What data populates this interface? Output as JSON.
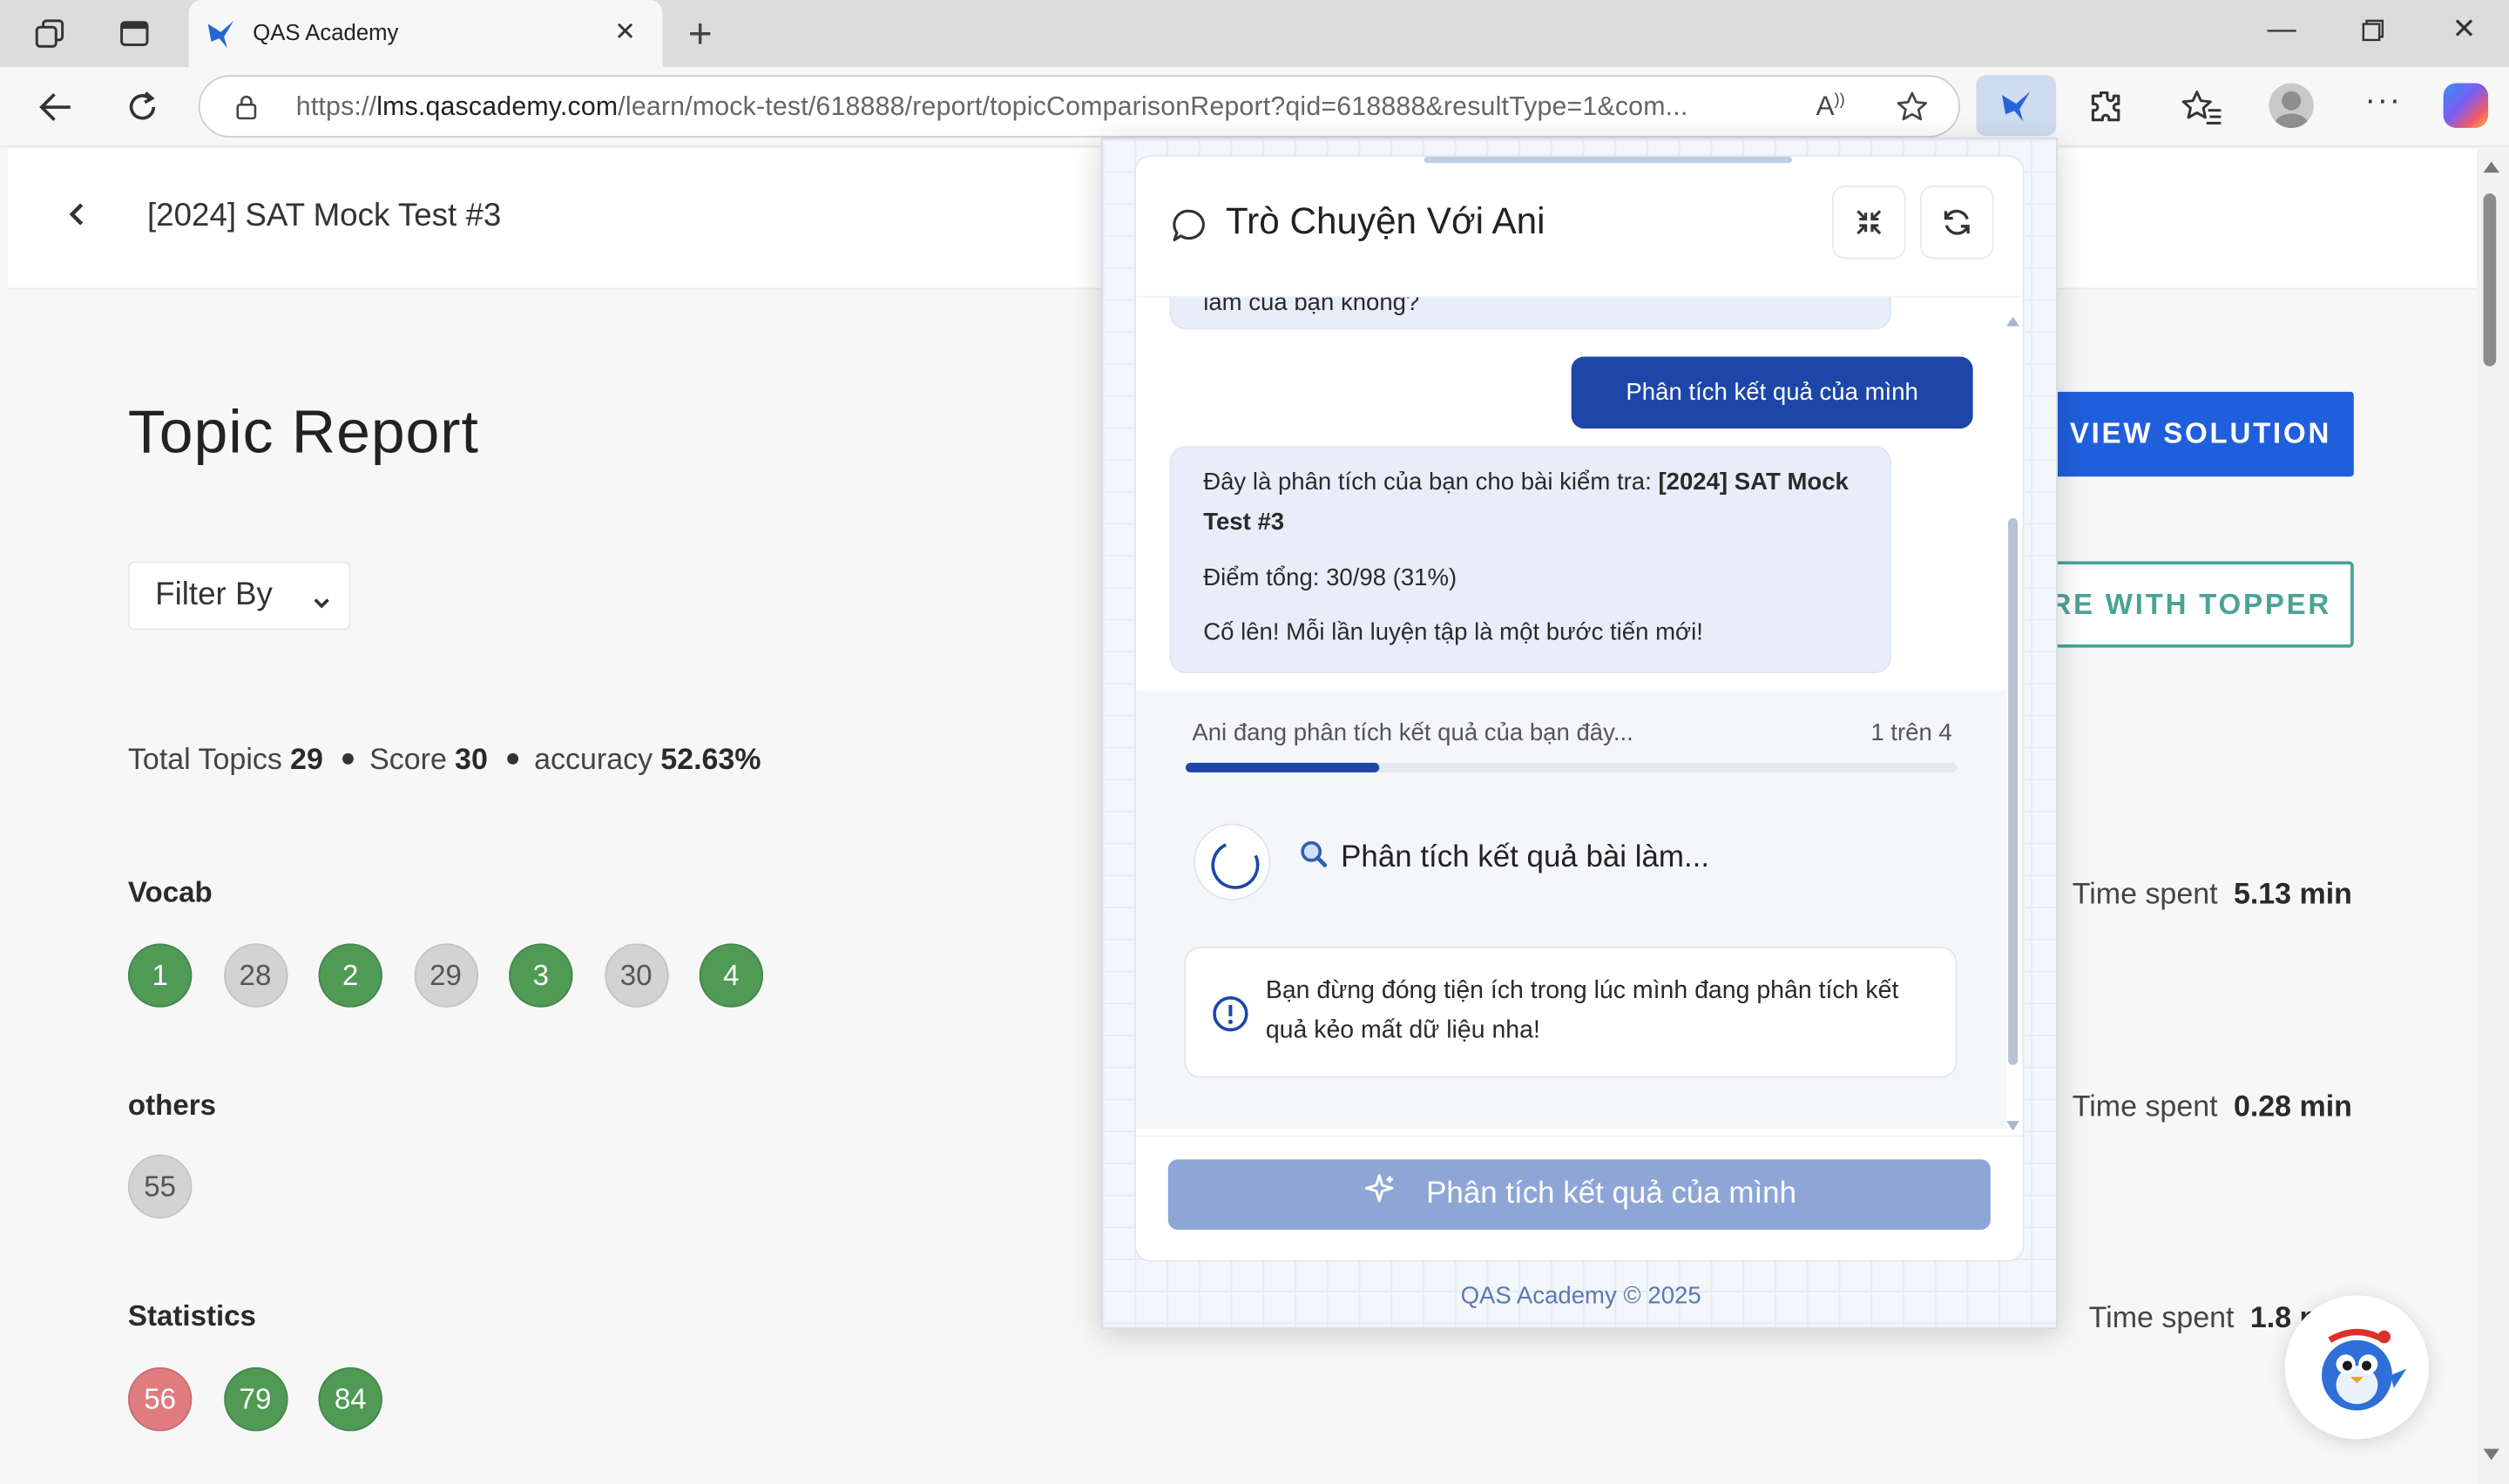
{
  "browser": {
    "tab_title": "QAS Academy",
    "url_prefix": "https://",
    "url_host": "lms.qascademy.com",
    "url_path": "/learn/mock-test/618888/report/topicComparisonReport?qid=618888&resultType=1&com..."
  },
  "page": {
    "title": "[2024] SAT Mock Test #3",
    "heading": "Topic Report",
    "filter_label": "Filter By",
    "stats": {
      "total_topics_label": "Total Topics",
      "total_topics_value": "29",
      "score_label": "Score",
      "score_value": "30",
      "accuracy_label": "accuracy",
      "accuracy_value": "52.63%"
    },
    "sections": [
      {
        "name": "Vocab",
        "items": [
          "1",
          "28",
          "2",
          "29",
          "3",
          "30",
          "4"
        ],
        "status": [
          "correct",
          "unanswered",
          "correct",
          "unanswered",
          "correct",
          "unanswered",
          "correct"
        ],
        "time_label": "Time spent",
        "time_value": "5.13 min"
      },
      {
        "name": "others",
        "items": [
          "55"
        ],
        "status": [
          "unanswered"
        ],
        "time_label": "Time spent",
        "time_value": "0.28 min"
      },
      {
        "name": "Statistics",
        "items": [
          "56",
          "79",
          "84"
        ],
        "status": [
          "incorrect",
          "correct",
          "correct"
        ],
        "time_label": "Time spent",
        "time_value": "1.8 min"
      }
    ],
    "view_solution_label": "VIEW SOLUTION",
    "compare_label": "RE WITH TOPPER"
  },
  "chat": {
    "title": "Trò Chuyện Với Ani",
    "partial_message": "làm của bạn không?",
    "user_message": "Phân tích kết quả của mình",
    "bot_message": {
      "intro": "Đây là phân tích của bạn cho bài kiểm tra:",
      "test_name": "[2024] SAT Mock Test #3",
      "score_line": "Điểm tổng: 30/98 (31%)",
      "encouragement": "Cố lên! Mỗi lần luyện tập là một bước tiến mới!"
    },
    "progress_label": "Ani đang phân tích kết quả của bạn đây...",
    "progress_count": "1 trên 4",
    "progress_fraction": 0.25,
    "step_text": "Phân tích kết quả bài làm...",
    "warning": "Bạn đừng đóng tiện ích trong lúc mình đang phân tích kết quả kẻo mất dữ liệu nha!",
    "analyze_button": "Phân tích kết quả của mình",
    "copyright": "QAS Academy © 2025"
  },
  "colors": {
    "correct": "#4f9a55",
    "unanswered": "#d3d3d3",
    "incorrect": "#e07c80",
    "primary": "#1f5fdc",
    "chat_primary": "#1d46a8",
    "topper": "#4aa394"
  },
  "icons": [
    "workspaces-icon",
    "tab-actions-icon",
    "qas-favicon",
    "close-icon",
    "plus-icon",
    "minimize-icon",
    "restore-icon",
    "window-close-icon",
    "back-arrow-icon",
    "refresh-icon",
    "lock-icon",
    "read-aloud-icon",
    "star-icon",
    "extension-icon",
    "favorites-icon",
    "profile-icon",
    "more-icon",
    "copilot-icon",
    "chevron-left-icon",
    "chevron-down-icon",
    "chat-bubble-icon",
    "collapse-icon",
    "reload-icon",
    "search-icon",
    "info-icon",
    "sparkle-icon",
    "mascot-icon"
  ]
}
